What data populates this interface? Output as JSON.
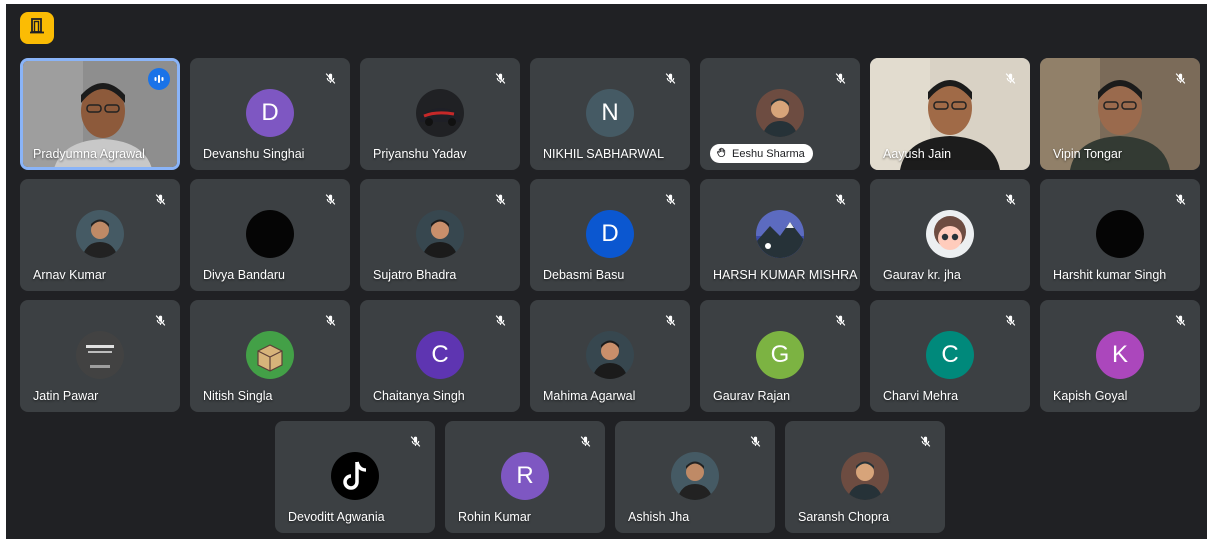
{
  "colors": {
    "background": "#202124",
    "tile": "#3c4043",
    "active_border": "#8ab4f8",
    "speaking": "#1a73e8",
    "leave_button": "#fbbc04"
  },
  "toolbar": {
    "top_button_icon": "door-exit-icon"
  },
  "participants": [
    {
      "name": "Pradyumna Agrawal",
      "avatar": "video",
      "speaking": true
    },
    {
      "name": "Devanshu Singhai",
      "avatar": "letter",
      "letter": "D",
      "color": "#7e57c2",
      "muted": true
    },
    {
      "name": "Priyanshu Yadav",
      "avatar": "photo",
      "photo": "car-photo",
      "muted": true
    },
    {
      "name": "NIKHIL SABHARWAL",
      "avatar": "letter",
      "letter": "N",
      "color": "#455a64",
      "muted": true
    },
    {
      "name": "Eeshu Sharma",
      "avatar": "photo",
      "photo": "person-photo",
      "muted": true,
      "hand_raised": true
    },
    {
      "name": "Aayush Jain",
      "avatar": "video",
      "muted": true
    },
    {
      "name": "Vipin Tongar",
      "avatar": "video",
      "muted": true
    },
    {
      "name": "Arnav Kumar",
      "avatar": "photo",
      "photo": "person-photo",
      "muted": true
    },
    {
      "name": "Divya Bandaru",
      "avatar": "photo",
      "photo": "dark-photo",
      "muted": true
    },
    {
      "name": "Sujatro Bhadra",
      "avatar": "photo",
      "photo": "person-photo",
      "muted": true
    },
    {
      "name": "Debasmi Basu",
      "avatar": "letter",
      "letter": "D",
      "color": "#0b57d0",
      "muted": true
    },
    {
      "name": "HARSH KUMAR MISHRA",
      "avatar": "photo",
      "photo": "mountain-photo",
      "muted": true
    },
    {
      "name": "Gaurav kr. jha",
      "avatar": "photo",
      "photo": "doll-photo",
      "muted": true
    },
    {
      "name": "Harshit kumar Singh",
      "avatar": "photo",
      "photo": "dark-photo",
      "muted": true
    },
    {
      "name": "Jatin Pawar",
      "avatar": "photo",
      "photo": "logo-photo",
      "muted": true
    },
    {
      "name": "Nitish Singla",
      "avatar": "photo",
      "photo": "box-photo",
      "muted": true
    },
    {
      "name": "Chaitanya Singh",
      "avatar": "letter",
      "letter": "C",
      "color": "#5e35b1",
      "muted": true
    },
    {
      "name": "Mahima Agarwal",
      "avatar": "photo",
      "photo": "person-photo",
      "muted": true
    },
    {
      "name": "Gaurav Rajan",
      "avatar": "letter",
      "letter": "G",
      "color": "#7cb342",
      "muted": true
    },
    {
      "name": "Charvi Mehra",
      "avatar": "letter",
      "letter": "C",
      "color": "#00897b",
      "muted": true
    },
    {
      "name": "Kapish Goyal",
      "avatar": "letter",
      "letter": "K",
      "color": "#ab47bc",
      "muted": true
    },
    {
      "name": "Devoditt Agwania",
      "avatar": "photo",
      "photo": "tiktok-photo",
      "muted": true
    },
    {
      "name": "Rohin Kumar",
      "avatar": "letter",
      "letter": "R",
      "color": "#7e57c2",
      "muted": true
    },
    {
      "name": "Ashish Jha",
      "avatar": "photo",
      "photo": "person-photo",
      "muted": true
    },
    {
      "name": "Saransh Chopra",
      "avatar": "photo",
      "photo": "person-photo",
      "muted": true
    }
  ]
}
